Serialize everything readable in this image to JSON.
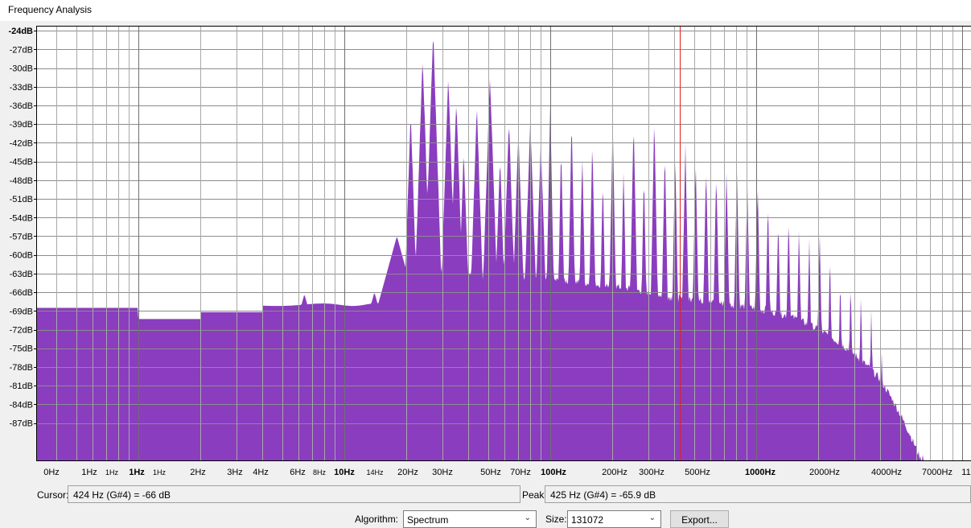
{
  "window": {
    "title": "Frequency Analysis"
  },
  "chart_data": {
    "type": "area",
    "title": "",
    "xscale": "log",
    "y_tick_labels": [
      "-24dB",
      "-27dB",
      "-30dB",
      "-33dB",
      "-36dB",
      "-39dB",
      "-42dB",
      "-45dB",
      "-48dB",
      "-51dB",
      "-54dB",
      "-57dB",
      "-60dB",
      "-63dB",
      "-66dB",
      "-69dB",
      "-72dB",
      "-75dB",
      "-78dB",
      "-81dB",
      "-84dB",
      "-87dB"
    ],
    "y_ticks": [
      -24,
      -27,
      -30,
      -33,
      -36,
      -39,
      -42,
      -45,
      -48,
      -51,
      -54,
      -57,
      -60,
      -63,
      -66,
      -69,
      -72,
      -75,
      -78,
      -81,
      -84,
      -87
    ],
    "ylim": [
      -93,
      -23.2
    ],
    "x_tick_labels": [
      {
        "label": "0Hz",
        "style": "normal"
      },
      {
        "label": "1Hz",
        "style": "normal"
      },
      {
        "label": "1Hz",
        "style": "small"
      },
      {
        "label": "1Hz",
        "style": "bold"
      },
      {
        "label": "1Hz",
        "style": "small"
      },
      {
        "label": "2Hz",
        "style": "normal"
      },
      {
        "label": "3Hz",
        "style": "normal"
      },
      {
        "label": "4Hz",
        "style": "normal"
      },
      {
        "label": "6Hz",
        "style": "normal"
      },
      {
        "label": "8Hz",
        "style": "small"
      },
      {
        "label": "10Hz",
        "style": "bold"
      },
      {
        "label": "14Hz",
        "style": "small"
      },
      {
        "label": "20Hz",
        "style": "normal"
      },
      {
        "label": "30Hz",
        "style": "normal"
      },
      {
        "label": "50Hz",
        "style": "normal"
      },
      {
        "label": "70Hz",
        "style": "normal"
      },
      {
        "label": "100Hz",
        "style": "bold"
      },
      {
        "label": "200Hz",
        "style": "normal"
      },
      {
        "label": "300Hz",
        "style": "normal"
      },
      {
        "label": "500Hz",
        "style": "normal"
      },
      {
        "label": "1000Hz",
        "style": "bold"
      },
      {
        "label": "2000Hz",
        "style": "normal"
      },
      {
        "label": "4000Hz",
        "style": "normal"
      },
      {
        "label": "7000Hz",
        "style": "normal"
      },
      {
        "label": "11",
        "style": "normal"
      }
    ],
    "cursor_marker_hz": 424,
    "series": [
      {
        "color": "#8a3dbe",
        "floor_db": -67,
        "peaks": [
          {
            "hz": 6.4,
            "db": -66.3
          },
          {
            "hz": 7.3,
            "db": -68
          },
          {
            "hz": 9,
            "db": -69
          },
          {
            "hz": 11,
            "db": -68
          },
          {
            "hz": 14,
            "db": -66
          },
          {
            "hz": 16,
            "db": -64
          },
          {
            "hz": 18,
            "db": -57
          },
          {
            "hz": 21,
            "db": -37
          },
          {
            "hz": 24,
            "db": -28
          },
          {
            "hz": 27,
            "db": -24
          },
          {
            "hz": 32,
            "db": -31
          },
          {
            "hz": 35,
            "db": -35
          },
          {
            "hz": 38,
            "db": -43
          },
          {
            "hz": 44,
            "db": -36
          },
          {
            "hz": 51,
            "db": -31
          },
          {
            "hz": 57,
            "db": -44
          },
          {
            "hz": 63,
            "db": -38
          },
          {
            "hz": 70,
            "db": -40
          },
          {
            "hz": 80,
            "db": -38
          },
          {
            "hz": 90,
            "db": -42
          },
          {
            "hz": 100,
            "db": -36
          },
          {
            "hz": 113,
            "db": -42
          },
          {
            "hz": 127,
            "db": -38
          },
          {
            "hz": 143,
            "db": -43
          },
          {
            "hz": 160,
            "db": -41
          },
          {
            "hz": 180,
            "db": -47
          },
          {
            "hz": 201,
            "db": -39
          },
          {
            "hz": 227,
            "db": -46
          },
          {
            "hz": 254,
            "db": -38
          },
          {
            "hz": 285,
            "db": -47
          },
          {
            "hz": 320,
            "db": -38
          },
          {
            "hz": 360,
            "db": -43
          },
          {
            "hz": 404,
            "db": -44
          },
          {
            "hz": 425,
            "db": -65.9
          },
          {
            "hz": 453,
            "db": -42
          },
          {
            "hz": 508,
            "db": -44
          },
          {
            "hz": 571,
            "db": -45
          },
          {
            "hz": 640,
            "db": -46
          },
          {
            "hz": 718,
            "db": -46
          },
          {
            "hz": 806,
            "db": -46
          },
          {
            "hz": 905,
            "db": -48
          },
          {
            "hz": 1016,
            "db": -48
          },
          {
            "hz": 1140,
            "db": -51
          },
          {
            "hz": 1280,
            "db": -53
          },
          {
            "hz": 1437,
            "db": -53
          },
          {
            "hz": 1613,
            "db": -55
          },
          {
            "hz": 1810,
            "db": -57
          },
          {
            "hz": 2032,
            "db": -56
          },
          {
            "hz": 2280,
            "db": -60
          },
          {
            "hz": 2560,
            "db": -63
          },
          {
            "hz": 2873,
            "db": -64
          },
          {
            "hz": 3225,
            "db": -66
          },
          {
            "hz": 3620,
            "db": -69
          },
          {
            "hz": 4063,
            "db": -75
          },
          {
            "hz": 4560,
            "db": -81
          },
          {
            "hz": 5119,
            "db": -85
          },
          {
            "hz": 5746,
            "db": -88
          },
          {
            "hz": 6450,
            "db": -90
          }
        ]
      }
    ]
  },
  "status": {
    "cursor_label": "Cursor:",
    "cursor_value": "424 Hz (G#4) = -66 dB",
    "peak_label": "Peak:",
    "peak_value": "425 Hz (G#4) = -65.9 dB"
  },
  "controls": {
    "algorithm_label": "Algorithm:",
    "algorithm_value": "Spectrum",
    "size_label": "Size:",
    "size_value": "131072",
    "export_label": "Export...",
    "chevron_icon": "chevron-down-icon"
  }
}
